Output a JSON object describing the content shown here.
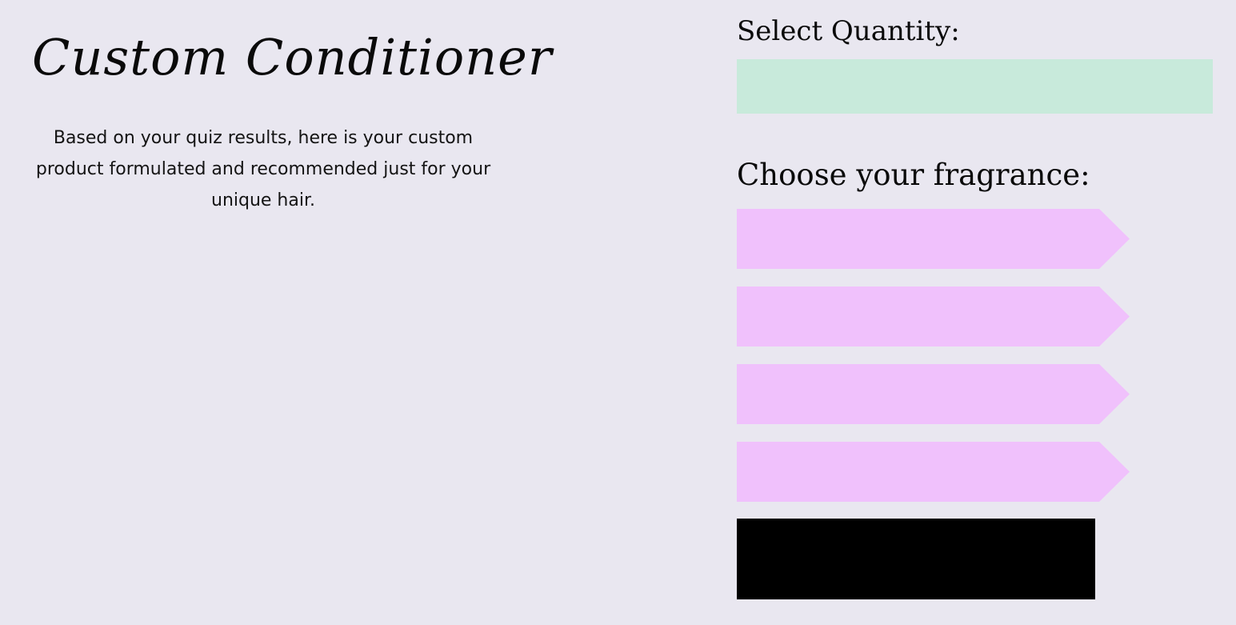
{
  "colors": {
    "page_background": "#e9e7f0",
    "quantity_field": "#c8eadb",
    "fragrance_option": "#f0c1fc",
    "add_to_cart_button": "#000000"
  },
  "product": {
    "title": "Custom Conditioner",
    "description": "Based on your quiz results, here is your custom product formulated and recommended just for your unique hair."
  },
  "quantity": {
    "heading": "Select Quantity:",
    "value": ""
  },
  "fragrance": {
    "heading": "Choose your fragrance:",
    "options": [
      {
        "label": ""
      },
      {
        "label": ""
      },
      {
        "label": ""
      },
      {
        "label": ""
      }
    ]
  },
  "cart_button": {
    "label": ""
  }
}
